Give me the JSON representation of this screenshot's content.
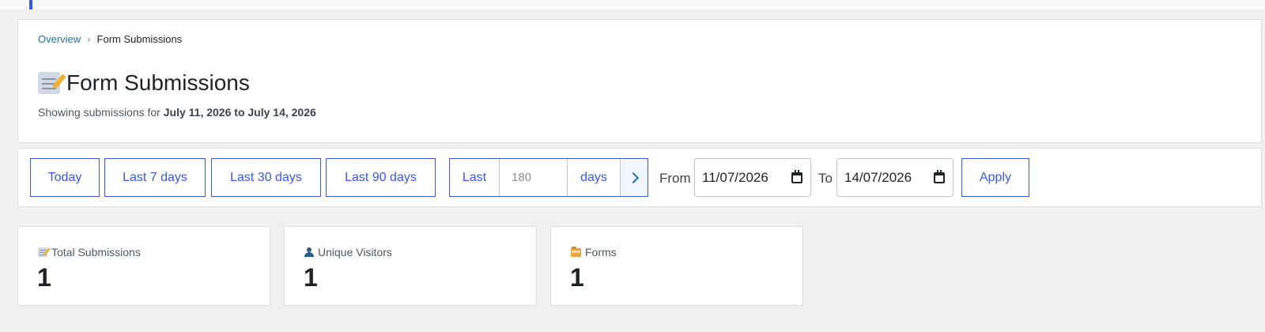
{
  "breadcrumb": {
    "parent": "Overview",
    "current": "Form Submissions"
  },
  "header": {
    "title": "Form Submissions",
    "subtitle_prefix": "Showing submissions for ",
    "date_start": "July 11, 2026",
    "date_joiner": " to ",
    "date_end": "July 14, 2026"
  },
  "filters": {
    "presets": [
      {
        "label": "Today"
      },
      {
        "label": "Last 7 days"
      },
      {
        "label": "Last 30 days"
      },
      {
        "label": "Last 90 days"
      }
    ],
    "custom": {
      "prefix": "Last",
      "placeholder": "180",
      "suffix": "days"
    },
    "from_label": "From",
    "from_value": "11/07/2026",
    "to_label": "To",
    "to_value": "14/07/2026",
    "apply_label": "Apply"
  },
  "stats": [
    {
      "label": "Total Submissions",
      "value": "1",
      "icon": "memo-icon"
    },
    {
      "label": "Unique Visitors",
      "value": "1",
      "icon": "person-icon"
    },
    {
      "label": "Forms",
      "value": "1",
      "icon": "folder-icon"
    }
  ],
  "colors": {
    "accent": "#3858e9",
    "link": "#2271b1",
    "background": "#f0f0f1"
  }
}
